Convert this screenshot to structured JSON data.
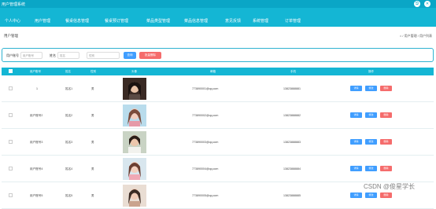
{
  "window": {
    "title": "用户管理系统"
  },
  "nav": [
    "个人中心",
    "用户管理",
    "餐桌信息管理",
    "餐桌预订管理",
    "菜品类型管理",
    "菜品信息管理",
    "意见反馈",
    "系统管理",
    "订单管理"
  ],
  "page": {
    "title": "用户管理",
    "breadcrumb": "⌂ / 用户管理 / 用户列表"
  },
  "search": {
    "account_label": "用户账号",
    "account_placeholder": "用户账号",
    "name_label": "姓名",
    "name_placeholder": "姓名",
    "gender_label": "性别",
    "gender_value": "性别",
    "query_button": "查询",
    "batch_delete_button": "批量删除"
  },
  "table": {
    "headers": [
      "用户账号",
      "姓名",
      "性别",
      "头像",
      "邮箱",
      "手机",
      "操作"
    ],
    "rows": [
      {
        "account": "1",
        "name": "姓名1",
        "gender": "男",
        "email": "773890001@qq.com",
        "phone": "13823888881"
      },
      {
        "account": "用户账号2",
        "name": "姓名2",
        "gender": "男",
        "email": "773890002@qq.com",
        "phone": "13823888882"
      },
      {
        "account": "用户账号3",
        "name": "姓名3",
        "gender": "男",
        "email": "773890003@qq.com",
        "phone": "13823888883"
      },
      {
        "account": "用户账号4",
        "name": "姓名4",
        "gender": "男",
        "email": "773890004@qq.com",
        "phone": "13823888884"
      },
      {
        "account": "用户账号5",
        "name": "姓名5",
        "gender": "男",
        "email": "773890005@qq.com",
        "phone": "13823888885"
      }
    ],
    "actions": {
      "view": "详情",
      "edit": "修改",
      "delete": "删除"
    }
  },
  "watermark": "CSDN @俊星学长",
  "colors": {
    "primary": "#14b6d4",
    "dark_primary": "#0aa6c6",
    "view_btn": "#409eff",
    "edit_btn": "#409eff",
    "delete_btn": "#f56c6c"
  },
  "icons": {
    "logout": "logout-icon",
    "close": "close-icon"
  }
}
